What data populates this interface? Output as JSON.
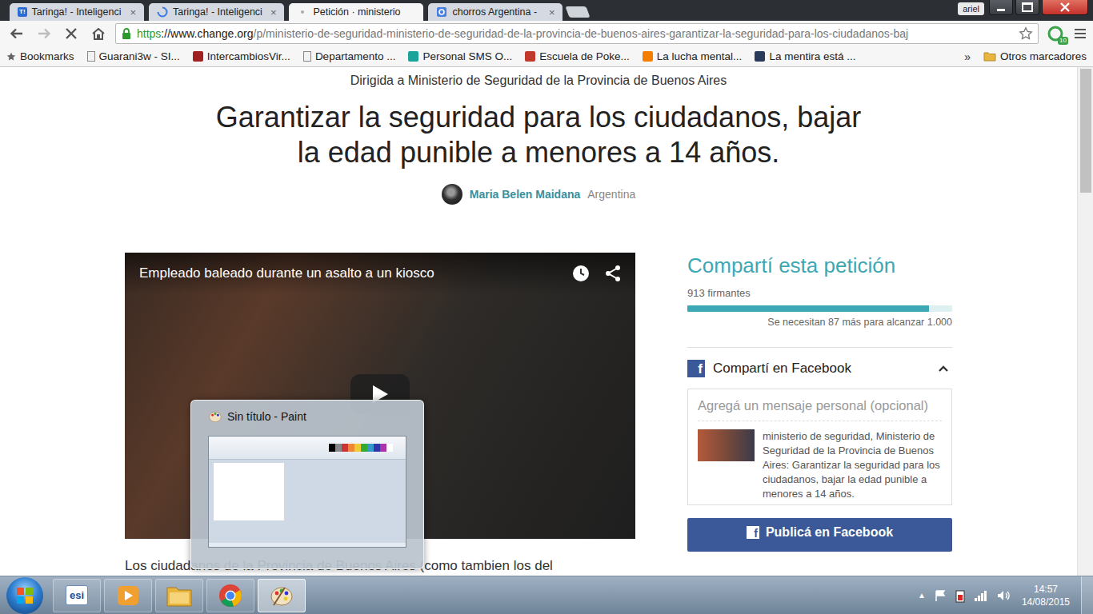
{
  "browser": {
    "tabs": [
      {
        "label": "Taringa! - Inteligenci",
        "icon": "taringa",
        "favicon": "T!",
        "close": "×",
        "selected": false
      },
      {
        "label": "Taringa! - Inteligenci",
        "icon": "spinner",
        "close": "×",
        "selected": false
      },
      {
        "label": "Petición · ministerio",
        "icon": "change",
        "selected": true
      },
      {
        "label": "chorros Argentina - ",
        "icon": "google",
        "close": "×",
        "selected": false
      }
    ],
    "profile": "ariel",
    "address": {
      "scheme": "https",
      "host": "://www.change.org",
      "path": "/p/ministerio-de-seguridad-ministerio-de-seguridad-de-la-provincia-de-buenos-aires-garantizar-la-seguridad-para-los-ciudadanos-baj"
    },
    "extension_badge": "10",
    "bookmarks": [
      {
        "label": "Bookmarks",
        "kind": "star",
        "color": "#666666"
      },
      {
        "label": "Guarani3w - SI...",
        "kind": "page",
        "color": "#f2f2f2"
      },
      {
        "label": "IntercambiosVir...",
        "kind": "logo",
        "color": "#a02020"
      },
      {
        "label": "Departamento ...",
        "kind": "page",
        "color": "#f2f2f2"
      },
      {
        "label": "Personal SMS O...",
        "kind": "logo",
        "color": "#1aa39a"
      },
      {
        "label": "Escuela de Poke...",
        "kind": "logo",
        "color": "#c0392b"
      },
      {
        "label": "La lucha mental...",
        "kind": "logo",
        "color": "#f57d00"
      },
      {
        "label": "La mentira está ...",
        "kind": "logo",
        "color": "#2a3a5a"
      }
    ],
    "bookmarks_overflow": "»",
    "other_bookmarks": "Otros marcadores"
  },
  "page": {
    "target": "Dirigida a Ministerio de Seguridad de la Provincia de Buenos Aires",
    "title_lines": [
      "Garantizar la seguridad para los ciudadanos, bajar",
      "la edad punible a menores a 14 años."
    ],
    "author": "Maria Belen Maidana",
    "country": "Argentina",
    "video": {
      "title": "Empleado baleado durante un asalto a un kiosco"
    },
    "body": "Los ciudadanos de la Provincia de Buenos Aires (como tambien los del",
    "share": {
      "heading": "Compartí esta petición",
      "signers": "913 firmantes",
      "level": 0.913,
      "remaining": "Se necesitan 87 más para alcanzar 1.000"
    },
    "facebook": {
      "logo": "f",
      "heading": "Compartí en Facebook",
      "expanded": true,
      "placeholder": "Agregá un mensaje personal (opcional)",
      "preview": "ministerio de seguridad, Ministerio de Seguridad de la Provincia de Buenos Aires: Garantizar la seguridad para los ciudadanos, bajar la edad punible a menores a 14 años.",
      "button": "Publicá en Facebook"
    }
  },
  "thumbnail": {
    "title": "Sin título - Paint"
  },
  "taskbar": {
    "buttons": [
      {
        "kind": "esi",
        "label": "esi",
        "selected": false
      },
      {
        "kind": "media-player",
        "selected": false
      },
      {
        "kind": "explorer",
        "selected": false
      },
      {
        "kind": "chrome",
        "selected": false
      },
      {
        "kind": "paint",
        "selected": true
      }
    ],
    "tray": {
      "overflow": "▲",
      "time": "14:57",
      "date": "14/08/2015"
    }
  }
}
